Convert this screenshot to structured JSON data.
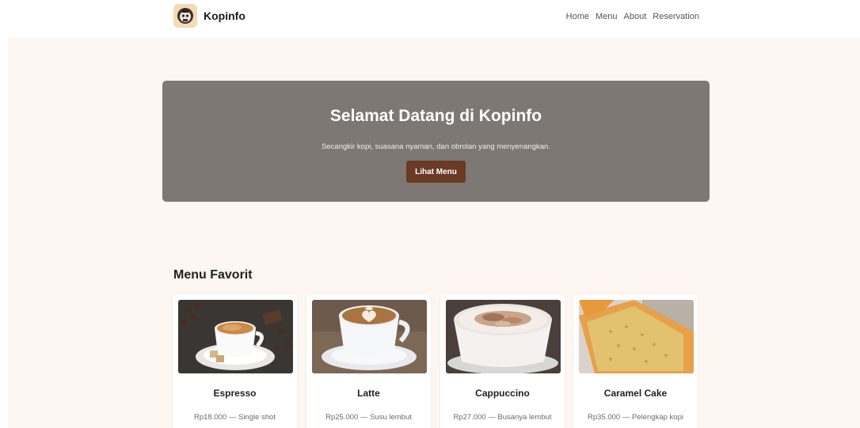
{
  "brand": {
    "name": "Kopinfo",
    "logo_icon": "face-logo-icon"
  },
  "nav": {
    "links": [
      "Home",
      "Menu",
      "About",
      "Reservation"
    ]
  },
  "hero": {
    "title": "Selamat Datang di Kopinfo",
    "subtitle": "Secangkir kopi, suasana nyaman, dan obrolan yang menyenangkan.",
    "button_label": "Lihat Menu"
  },
  "menu": {
    "section_title": "Menu Favorit",
    "items": [
      {
        "name": "Espresso",
        "description": "Rp18.000 — Single shot",
        "image": "espresso-image"
      },
      {
        "name": "Latte",
        "description": "Rp25.000 — Susu lembut",
        "image": "latte-image"
      },
      {
        "name": "Cappuccino",
        "description": "Rp27.000 — Busanya lembut",
        "image": "cappuccino-image"
      },
      {
        "name": "Caramel Cake",
        "description": "Rp35.000 — Pelengkap kopi",
        "image": "caramel-cake-image"
      }
    ]
  },
  "colors": {
    "page_bg": "#fdf6f1",
    "hero_bg": "#7e7874",
    "button_bg": "#6b3a24",
    "logo_bg": "#f6d9b5"
  }
}
